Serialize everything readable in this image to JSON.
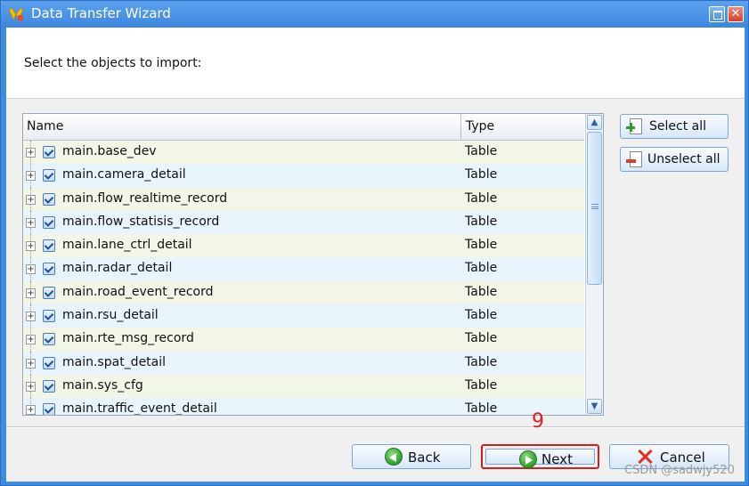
{
  "window": {
    "title": "Data Transfer Wizard",
    "close_glyph": "✕"
  },
  "header": {
    "instruction": "Select the objects to import:"
  },
  "table": {
    "columns": [
      "Name",
      "Type"
    ],
    "rows": [
      {
        "name": "main.base_dev",
        "type": "Table"
      },
      {
        "name": "main.camera_detail",
        "type": "Table"
      },
      {
        "name": "main.flow_realtime_record",
        "type": "Table"
      },
      {
        "name": "main.flow_statisis_record",
        "type": "Table"
      },
      {
        "name": "main.lane_ctrl_detail",
        "type": "Table"
      },
      {
        "name": "main.radar_detail",
        "type": "Table"
      },
      {
        "name": "main.road_event_record",
        "type": "Table"
      },
      {
        "name": "main.rsu_detail",
        "type": "Table"
      },
      {
        "name": "main.rte_msg_record",
        "type": "Table"
      },
      {
        "name": "main.spat_detail",
        "type": "Table"
      },
      {
        "name": "main.sys_cfg",
        "type": "Table"
      },
      {
        "name": "main.traffic_event_detail",
        "type": "Table"
      }
    ],
    "expander_glyph": "+",
    "scroll_up_glyph": "▲",
    "scroll_down_glyph": "▼"
  },
  "side_buttons": {
    "select_all": "Select all",
    "unselect_all": "Unselect all"
  },
  "footer": {
    "back": "Back",
    "next": "Next",
    "cancel": "Cancel"
  },
  "annotation": {
    "step_number": "9"
  },
  "watermark": "CSDN @sadwjy520",
  "icons": {
    "app": "wizard-app-icon",
    "maximize": "maximize-icon",
    "close": "close-icon",
    "select_all": "select-all-icon",
    "unselect_all": "unselect-all-icon",
    "back": "back-arrow-icon",
    "next": "next-arrow-icon",
    "cancel": "x-icon"
  },
  "colors": {
    "title_bar": "#3d86dc",
    "highlight_border": "#d02020",
    "row_odd": "#f1f6e6",
    "row_even": "#e8f4fb"
  }
}
